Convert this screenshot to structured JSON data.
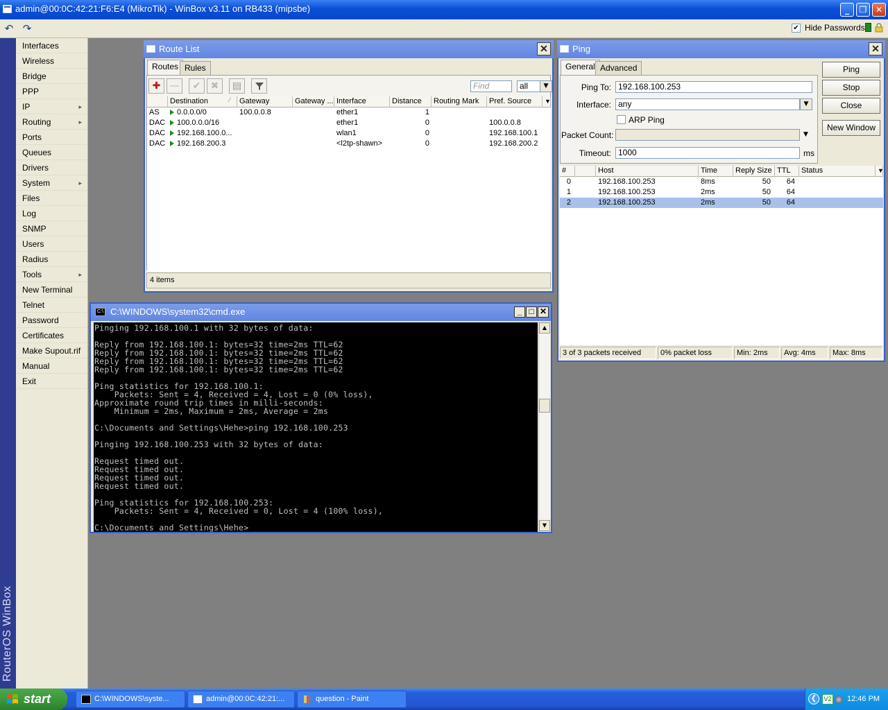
{
  "window": {
    "title": "admin@00:0C:42:21:F6:E4 (MikroTik) - WinBox v3.11 on RB433 (mipsbe)",
    "btn_min": "_",
    "btn_max": "❐",
    "btn_close": "✕"
  },
  "toolbar": {
    "undo_icon": "↶",
    "redo_icon": "↷",
    "hide_passwords_label": "Hide Passwords",
    "hide_passwords_checked": "✔",
    "status_color": "#1e8a23"
  },
  "brand": {
    "text": "RouterOS WinBox"
  },
  "menu": {
    "items": [
      {
        "label": "Interfaces",
        "arrow": ""
      },
      {
        "label": "Wireless",
        "arrow": ""
      },
      {
        "label": "Bridge",
        "arrow": ""
      },
      {
        "label": "PPP",
        "arrow": ""
      },
      {
        "label": "IP",
        "arrow": "▸"
      },
      {
        "label": "Routing",
        "arrow": "▸"
      },
      {
        "label": "Ports",
        "arrow": ""
      },
      {
        "label": "Queues",
        "arrow": ""
      },
      {
        "label": "Drivers",
        "arrow": ""
      },
      {
        "label": "System",
        "arrow": "▸"
      },
      {
        "label": "Files",
        "arrow": ""
      },
      {
        "label": "Log",
        "arrow": ""
      },
      {
        "label": "SNMP",
        "arrow": ""
      },
      {
        "label": "Users",
        "arrow": ""
      },
      {
        "label": "Radius",
        "arrow": ""
      },
      {
        "label": "Tools",
        "arrow": "▸"
      },
      {
        "label": "New Terminal",
        "arrow": ""
      },
      {
        "label": "Telnet",
        "arrow": ""
      },
      {
        "label": "Password",
        "arrow": ""
      },
      {
        "label": "Certificates",
        "arrow": ""
      },
      {
        "label": "Make Supout.rif",
        "arrow": ""
      },
      {
        "label": "Manual",
        "arrow": ""
      },
      {
        "label": "Exit",
        "arrow": ""
      }
    ]
  },
  "route_list": {
    "title": "Route List",
    "close": "✕",
    "tabs": [
      "Routes",
      "Rules"
    ],
    "find_placeholder": "Find",
    "filter_value": "all",
    "btn_add": "✚",
    "btn_remove": "—",
    "btn_enable": "✔",
    "btn_disable": "✖",
    "btn_comment": "▤",
    "columns": [
      "",
      "Destination",
      "Gateway",
      "Gateway ...",
      "Interface",
      "Distance",
      "Routing Mark",
      "Pref. Source"
    ],
    "sort_indicator": "⁄",
    "rows": [
      {
        "flags": "AS",
        "destination": "0.0.0.0/0",
        "gateway": "100.0.0.8",
        "gw_state": "",
        "interface": "ether1",
        "distance": "1",
        "mark": "",
        "pref_source": ""
      },
      {
        "flags": "DAC",
        "destination": "100.0.0.0/16",
        "gateway": "",
        "gw_state": "",
        "interface": "ether1",
        "distance": "0",
        "mark": "",
        "pref_source": "100.0.0.8"
      },
      {
        "flags": "DAC",
        "destination": "192.168.100.0...",
        "gateway": "",
        "gw_state": "",
        "interface": "wlan1",
        "distance": "0",
        "mark": "",
        "pref_source": "192.168.100.1"
      },
      {
        "flags": "DAC",
        "destination": "192.168.200.3",
        "gateway": "",
        "gw_state": "",
        "interface": "<l2tp-shawn>",
        "distance": "0",
        "mark": "",
        "pref_source": "192.168.200.2"
      }
    ],
    "status": "4 items"
  },
  "ping": {
    "title": "Ping",
    "close": "✕",
    "tabs": [
      "General",
      "Advanced"
    ],
    "ping_to_label": "Ping To:",
    "ping_to_value": "192.168.100.253",
    "interface_label": "Interface:",
    "interface_value": "any",
    "arp_label": "ARP Ping",
    "packet_count_label": "Packet Count:",
    "packet_count_value": "",
    "timeout_label": "Timeout:",
    "timeout_value": "1000",
    "timeout_unit": "ms",
    "buttons": [
      "Ping",
      "Stop",
      "Close",
      "New Window"
    ],
    "columns": [
      "#",
      "",
      "Host",
      "Time",
      "Reply Size",
      "TTL",
      "Status"
    ],
    "rows": [
      {
        "n": "0",
        "host": "192.168.100.253",
        "time": "8ms",
        "size": "50",
        "ttl": "64",
        "status": ""
      },
      {
        "n": "1",
        "host": "192.168.100.253",
        "time": "2ms",
        "size": "50",
        "ttl": "64",
        "status": ""
      },
      {
        "n": "2",
        "host": "192.168.100.253",
        "time": "2ms",
        "size": "50",
        "ttl": "64",
        "status": ""
      }
    ],
    "status_bar": [
      "3 of 3 packets received",
      "0% packet loss",
      "Min: 2ms",
      "Avg: 4ms",
      "Max: 8ms"
    ]
  },
  "cmd": {
    "title": "C:\\WINDOWS\\system32\\cmd.exe",
    "icon_text": "C:\\",
    "btn_min": "_",
    "btn_max": "□",
    "btn_close": "✕",
    "output": "Pinging 192.168.100.1 with 32 bytes of data:\n\nReply from 192.168.100.1: bytes=32 time=2ms TTL=62\nReply from 192.168.100.1: bytes=32 time=2ms TTL=62\nReply from 192.168.100.1: bytes=32 time=2ms TTL=62\nReply from 192.168.100.1: bytes=32 time=2ms TTL=62\n\nPing statistics for 192.168.100.1:\n    Packets: Sent = 4, Received = 4, Lost = 0 (0% loss),\nApproximate round trip times in milli-seconds:\n    Minimum = 2ms, Maximum = 2ms, Average = 2ms\n\nC:\\Documents and Settings\\Hehe>ping 192.168.100.253\n\nPinging 192.168.100.253 with 32 bytes of data:\n\nRequest timed out.\nRequest timed out.\nRequest timed out.\nRequest timed out.\n\nPing statistics for 192.168.100.253:\n    Packets: Sent = 4, Received = 0, Lost = 4 (100% loss),\n\nC:\\Documents and Settings\\Hehe>_"
  },
  "taskbar": {
    "start_label": "start",
    "tasks": [
      "C:\\WINDOWS\\syste...",
      "admin@00:0C:42:21:...",
      "question - Paint"
    ],
    "tray_arrow": "❮",
    "clock": "12:46 PM"
  }
}
